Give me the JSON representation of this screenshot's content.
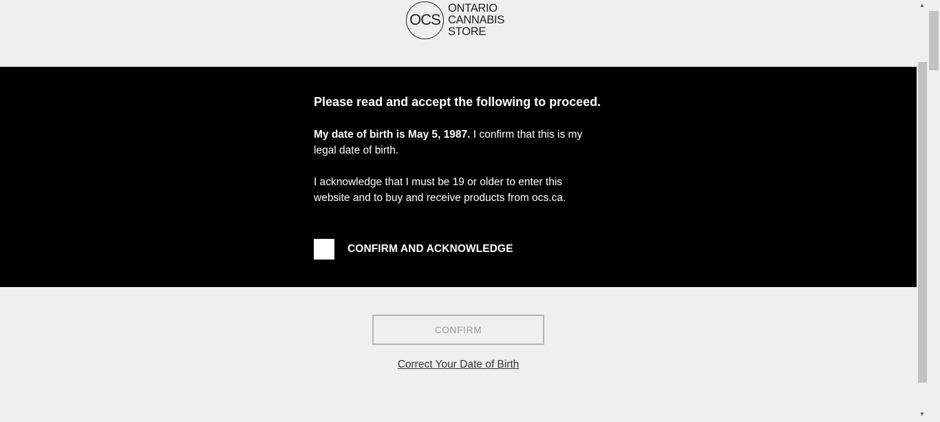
{
  "logo": {
    "monogram": "OCS",
    "line1": "ONTARIO",
    "line2": "CANNABIS",
    "line3": "STORE"
  },
  "gate": {
    "heading": "Please read and accept the following to proceed.",
    "dob_bold": "My date of birth is May 5, 1987.",
    "dob_rest": " I confirm that this is my legal date of birth.",
    "acknowledge": "I acknowledge that I must be 19 or older to enter this website and to buy and receive products from ocs.ca.",
    "checkbox_label": "CONFIRM AND ACKNOWLEDGE",
    "checkbox_checked": false
  },
  "actions": {
    "confirm_label": "CONFIRM",
    "correct_dob_label": "Correct Your Date of Birth"
  },
  "scrollbar": {
    "up_arrow": "▲",
    "down_arrow": "▼"
  }
}
